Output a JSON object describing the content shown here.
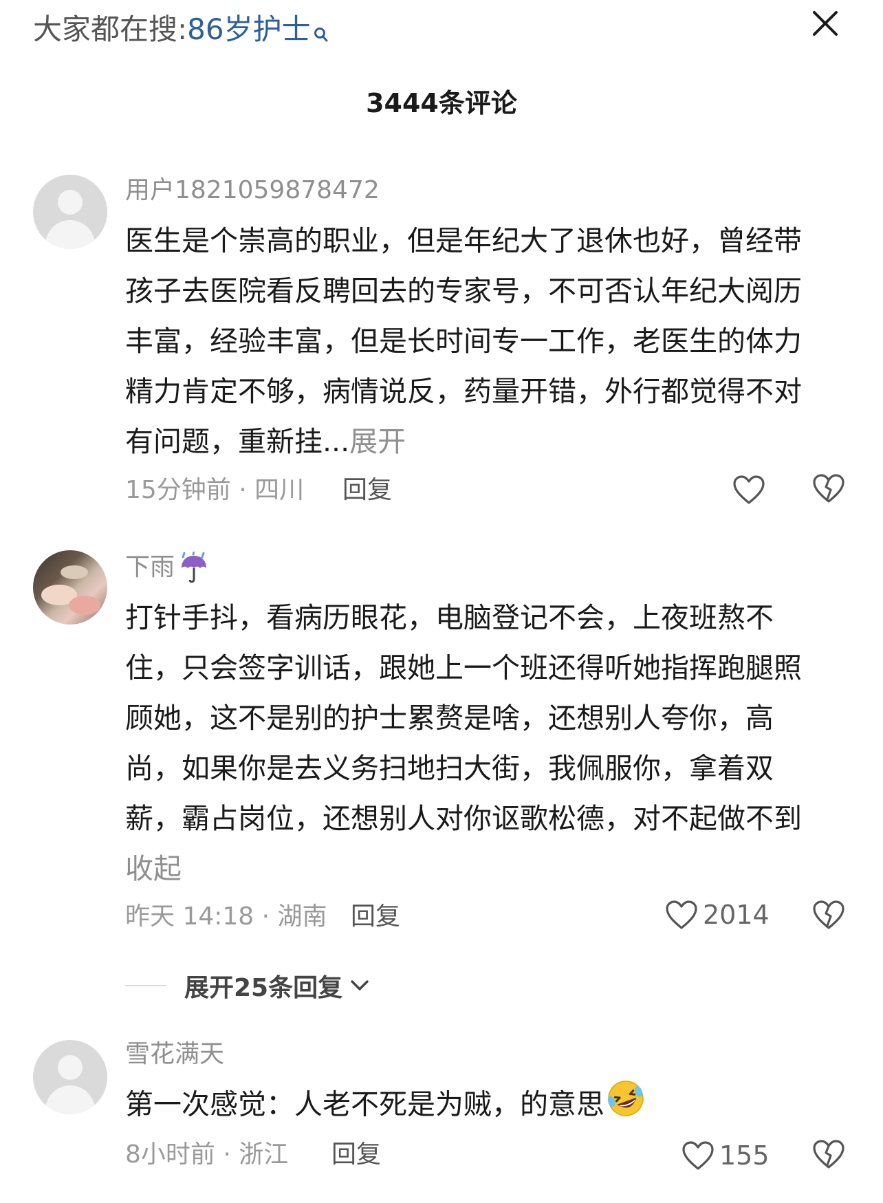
{
  "search_hint": {
    "prefix": "大家都在搜:",
    "keyword": "86岁护士"
  },
  "header": {
    "comment_count": "3444条评论"
  },
  "comments": [
    {
      "username": "用户1821059878472",
      "text": "医生是个崇高的职业，但是年纪大了退休也好，曾经带孩子去医院看反聘回去的专家号，不可否认年纪大阅历丰富，经验丰富，但是长时间专一工作，老医生的体力精力肯定不够，病情说反，药量开错，外行都觉得不对有问题，重新挂...",
      "more_label": "展开",
      "meta": "15分钟前 · 四川",
      "reply_label": "回复",
      "likes": ""
    },
    {
      "username": "下雨",
      "username_icon": "umbrella-with-rain-icon",
      "text": "打针手抖，看病历眼花，电脑登记不会，上夜班熬不住，只会签字训话，跟她上一个班还得听她指挥跑腿照顾她，这不是别的护士累赘是啥，还想别人夸你，高尚，如果你是去义务扫地扫大街，我佩服你，拿着双薪，霸占岗位，还想别人对你讴歌松德，对不起做不到",
      "more_label": "收起",
      "meta": "昨天 14:18 · 湖南",
      "reply_label": "回复",
      "likes": "2014",
      "expand_replies_label": "展开25条回复"
    },
    {
      "username": "雪花满天",
      "text": "第一次感觉：人老不死是为贼，的意思",
      "text_icon": "rolling-on-floor-laughing-emoji",
      "meta": "8小时前 · 浙江",
      "reply_label": "回复",
      "likes": "155"
    }
  ]
}
